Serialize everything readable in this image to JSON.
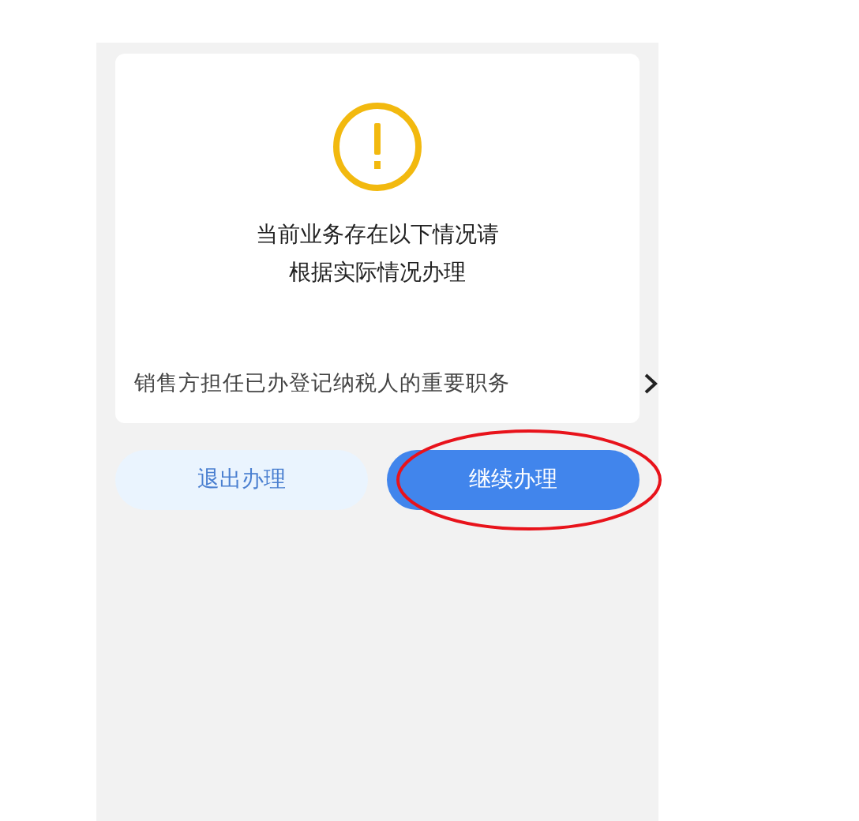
{
  "notice": {
    "message_lines": [
      "当前业务存在以下情况请",
      "根据实际情况办理"
    ]
  },
  "issues": [
    {
      "label": "销售方担任已办登记纳税人的重要职务"
    }
  ],
  "buttons": [
    {
      "label": "退出办理",
      "kind": "secondary",
      "circled": false
    },
    {
      "label": "继续办理",
      "kind": "primary",
      "circled": true
    }
  ]
}
